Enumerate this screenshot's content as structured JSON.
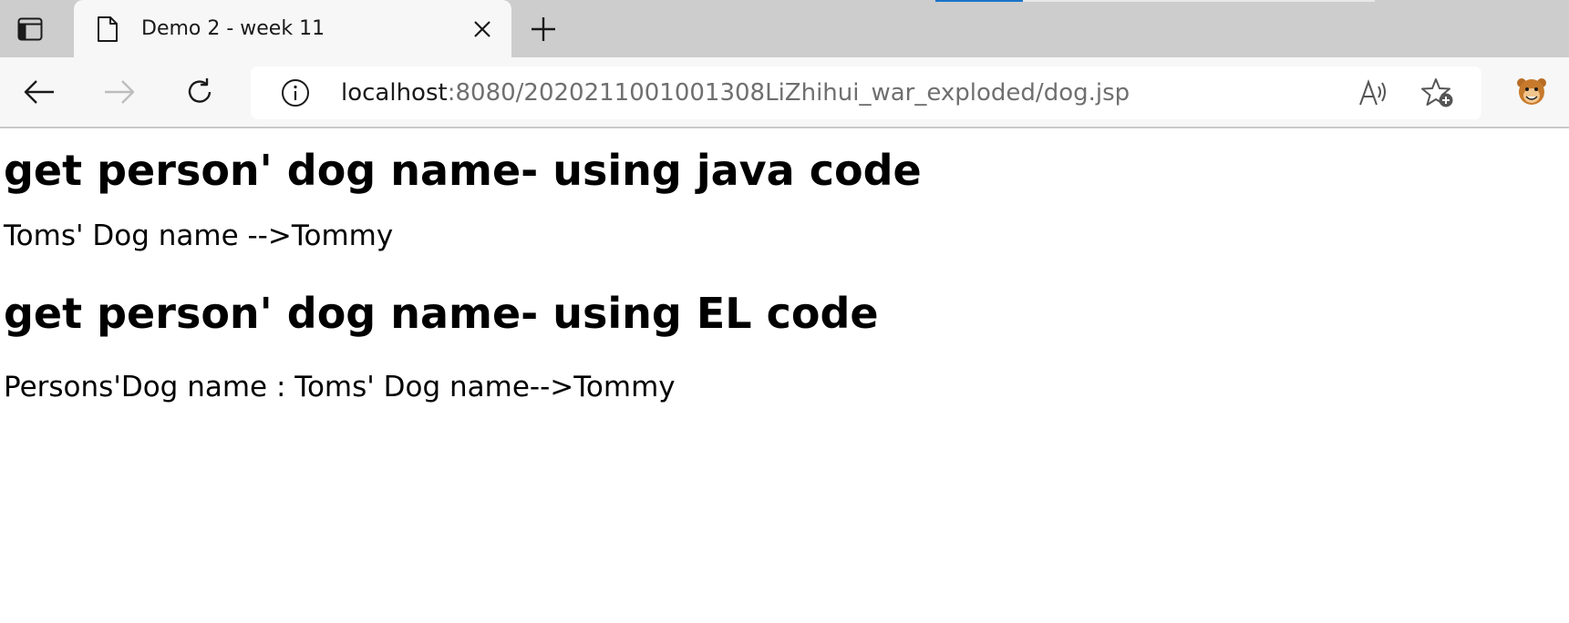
{
  "tab": {
    "title": "Demo 2 - week 11"
  },
  "address_bar": {
    "host": "localhost",
    "path": ":8080/2020211001001308LiZhihui_war_exploded/dog.jsp"
  },
  "page": {
    "heading_java": "get person' dog name- using java code",
    "text_java": "Toms' Dog name -->Tommy",
    "heading_el": "get person' dog name- using EL code",
    "text_el": "Persons'Dog name : Toms' Dog name-->Tommy"
  },
  "icons": {
    "tab_actions": "tab-actions-icon",
    "favicon": "document-icon",
    "close": "close-icon",
    "new_tab": "plus-icon",
    "back": "back-arrow-icon",
    "forward": "forward-arrow-icon",
    "refresh": "refresh-icon",
    "site_info": "info-icon",
    "read_aloud": "read-aloud-icon",
    "favorites": "add-favorite-icon",
    "profile": "profile-avatar-icon"
  },
  "colors": {
    "loading_accent": "#1a73c8",
    "tabstrip_bg": "#cdcdcd",
    "toolbar_bg": "#f7f7f7"
  }
}
